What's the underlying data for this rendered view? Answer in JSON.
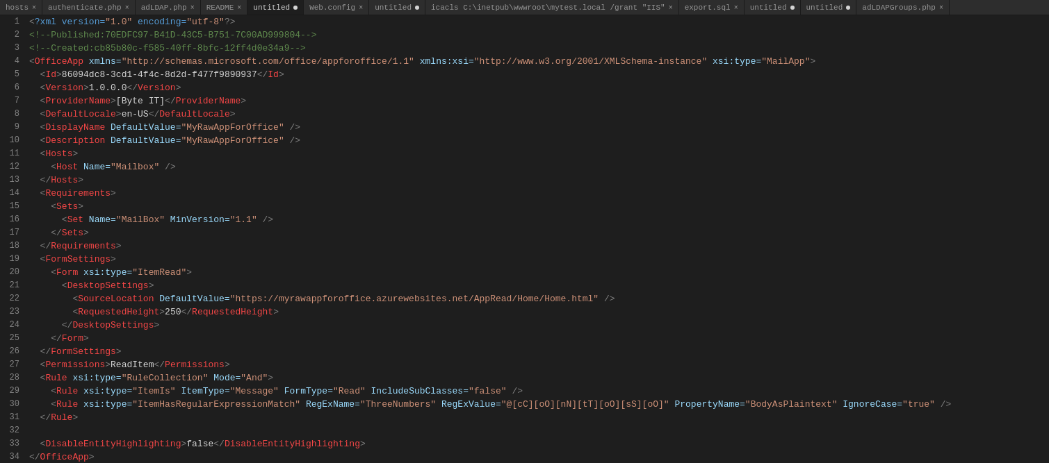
{
  "tabs": [
    {
      "label": "hosts",
      "active": false,
      "closable": true,
      "modified": false
    },
    {
      "label": "authenticate.php",
      "active": false,
      "closable": true,
      "modified": false
    },
    {
      "label": "adLDAP.php",
      "active": false,
      "closable": true,
      "modified": false
    },
    {
      "label": "README",
      "active": false,
      "closable": true,
      "modified": false
    },
    {
      "label": "untitled",
      "active": true,
      "closable": true,
      "modified": true
    },
    {
      "label": "Web.config",
      "active": false,
      "closable": true,
      "modified": false
    },
    {
      "label": "untitled",
      "active": false,
      "closable": true,
      "modified": true
    },
    {
      "label": "icacls C:\\inetpub\\wwwroot\\mytest.local /grant \"IIS\"",
      "active": false,
      "closable": true,
      "modified": false
    },
    {
      "label": "export.sql",
      "active": false,
      "closable": true,
      "modified": false
    },
    {
      "label": "untitled",
      "active": false,
      "closable": true,
      "modified": true
    },
    {
      "label": "untitled",
      "active": false,
      "closable": true,
      "modified": true
    },
    {
      "label": "adLDAPGroups.php",
      "active": false,
      "closable": true,
      "modified": false
    }
  ],
  "lines": [
    {
      "num": 1,
      "html": "<span class='lt'>&lt;</span><span class='pi'>?xml version=</span><span class='pi-val'>\"1.0\"</span><span class='pi'> encoding=</span><span class='pi-val'>\"utf-8\"</span><span class='lt'>?&gt;</span>"
    },
    {
      "num": 2,
      "html": "<span class='comment'>&lt;!--Published:70EDFC97-B41D-43C5-B751-7C00AD999804--&gt;</span>"
    },
    {
      "num": 3,
      "html": "<span class='comment'>&lt;!--Created:cb85b80c-f585-40ff-8bfc-12ff4d0e34a9--&gt;</span>"
    },
    {
      "num": 4,
      "html": "<span class='lt'>&lt;</span><span class='tag'>OfficeApp</span><span class='attr'> xmlns=</span><span class='attr-val'>\"http://schemas.microsoft.com/office/appforoffice/1.1\"</span><span class='attr'> xmlns:xsi=</span><span class='attr-val'>\"http://www.w3.org/2001/XMLSchema-instance\"</span><span class='attr'> xsi:type=</span><span class='attr-val'>\"MailApp\"</span><span class='lt'>&gt;</span>"
    },
    {
      "num": 5,
      "html": "  <span class='lt'>&lt;</span><span class='tag'>Id</span><span class='lt'>&gt;</span><span class='text-content'>86094dc8-3cd1-4f4c-8d2d-f477f9890937</span><span class='lt'>&lt;/</span><span class='tag'>Id</span><span class='lt'>&gt;</span>"
    },
    {
      "num": 6,
      "html": "  <span class='lt'>&lt;</span><span class='tag'>Version</span><span class='lt'>&gt;</span><span class='text-content'>1.0.0.0</span><span class='lt'>&lt;/</span><span class='tag'>Version</span><span class='lt'>&gt;</span>"
    },
    {
      "num": 7,
      "html": "  <span class='lt'>&lt;</span><span class='tag'>ProviderName</span><span class='lt'>&gt;</span><span class='text-content'>[Byte IT]</span><span class='lt'>&lt;/</span><span class='tag'>ProviderName</span><span class='lt'>&gt;</span>"
    },
    {
      "num": 8,
      "html": "  <span class='lt'>&lt;</span><span class='tag'>DefaultLocale</span><span class='lt'>&gt;</span><span class='text-content'>en-US</span><span class='lt'>&lt;/</span><span class='tag'>DefaultLocale</span><span class='lt'>&gt;</span>"
    },
    {
      "num": 9,
      "html": "  <span class='lt'>&lt;</span><span class='tag'>DisplayName</span><span class='attr'> DefaultValue=</span><span class='attr-val'>\"MyRawAppForOffice\"</span><span class='lt'> /&gt;</span>"
    },
    {
      "num": 10,
      "html": "  <span class='lt'>&lt;</span><span class='tag'>Description</span><span class='attr'> DefaultValue=</span><span class='attr-val'>\"MyRawAppForOffice\"</span><span class='lt'> /&gt;</span>"
    },
    {
      "num": 11,
      "html": "  <span class='lt'>&lt;</span><span class='tag'>Hosts</span><span class='lt'>&gt;</span>"
    },
    {
      "num": 12,
      "html": "    <span class='lt'>&lt;</span><span class='tag'>Host</span><span class='attr'> Name=</span><span class='attr-val'>\"Mailbox\"</span><span class='lt'> /&gt;</span>"
    },
    {
      "num": 13,
      "html": "  <span class='lt'>&lt;/</span><span class='tag'>Hosts</span><span class='lt'>&gt;</span>"
    },
    {
      "num": 14,
      "html": "  <span class='lt'>&lt;</span><span class='tag'>Requirements</span><span class='lt'>&gt;</span>"
    },
    {
      "num": 15,
      "html": "    <span class='lt'>&lt;</span><span class='tag'>Sets</span><span class='lt'>&gt;</span>"
    },
    {
      "num": 16,
      "html": "      <span class='lt'>&lt;</span><span class='tag'>Set</span><span class='attr'> Name=</span><span class='attr-val'>\"MailBox\"</span><span class='attr'> MinVersion=</span><span class='attr-val'>\"1.1\"</span><span class='lt'> /&gt;</span>"
    },
    {
      "num": 17,
      "html": "    <span class='lt'>&lt;/</span><span class='tag'>Sets</span><span class='lt'>&gt;</span>"
    },
    {
      "num": 18,
      "html": "  <span class='lt'>&lt;/</span><span class='tag'>Requirements</span><span class='lt'>&gt;</span>"
    },
    {
      "num": 19,
      "html": "  <span class='lt'>&lt;</span><span class='tag'>FormSettings</span><span class='lt'>&gt;</span>"
    },
    {
      "num": 20,
      "html": "    <span class='lt'>&lt;</span><span class='tag'>Form</span><span class='attr'> xsi:type=</span><span class='attr-val'>\"ItemRead\"</span><span class='lt'>&gt;</span>"
    },
    {
      "num": 21,
      "html": "      <span class='lt'>&lt;</span><span class='tag'>DesktopSettings</span><span class='lt'>&gt;</span>"
    },
    {
      "num": 22,
      "html": "        <span class='lt'>&lt;</span><span class='tag'>SourceLocation</span><span class='attr'> DefaultValue=</span><span class='attr-val'>\"https://myrawappforoffice.azurewebsites.net/AppRead/Home/Home.html\"</span><span class='lt'> /&gt;</span>"
    },
    {
      "num": 23,
      "html": "        <span class='lt'>&lt;</span><span class='tag'>RequestedHeight</span><span class='lt'>&gt;</span><span class='text-content'>250</span><span class='lt'>&lt;/</span><span class='tag'>RequestedHeight</span><span class='lt'>&gt;</span>"
    },
    {
      "num": 24,
      "html": "      <span class='lt'>&lt;/</span><span class='tag'>DesktopSettings</span><span class='lt'>&gt;</span>"
    },
    {
      "num": 25,
      "html": "    <span class='lt'>&lt;/</span><span class='tag'>Form</span><span class='lt'>&gt;</span>"
    },
    {
      "num": 26,
      "html": "  <span class='lt'>&lt;/</span><span class='tag'>FormSettings</span><span class='lt'>&gt;</span>"
    },
    {
      "num": 27,
      "html": "  <span class='lt'>&lt;</span><span class='tag'>Permissions</span><span class='lt'>&gt;</span><span class='text-content'>ReadItem</span><span class='lt'>&lt;/</span><span class='tag'>Permissions</span><span class='lt'>&gt;</span>"
    },
    {
      "num": 28,
      "html": "  <span class='lt'>&lt;</span><span class='tag'>Rule</span><span class='attr'> xsi:type=</span><span class='attr-val'>\"RuleCollection\"</span><span class='attr'> Mode=</span><span class='attr-val'>\"And\"</span><span class='lt'>&gt;</span>"
    },
    {
      "num": 29,
      "html": "    <span class='lt'>&lt;</span><span class='tag'>Rule</span><span class='attr'> xsi:type=</span><span class='attr-val'>\"ItemIs\"</span><span class='attr'> ItemType=</span><span class='attr-val'>\"Message\"</span><span class='attr'> FormType=</span><span class='attr-val'>\"Read\"</span><span class='attr'> IncludeSubClasses=</span><span class='attr-val'>\"false\"</span><span class='lt'> /&gt;</span>"
    },
    {
      "num": 30,
      "html": "    <span class='lt'>&lt;</span><span class='tag'>Rule</span><span class='attr'> xsi:type=</span><span class='attr-val'>\"ItemHasRegularExpressionMatch\"</span><span class='attr'> RegExName=</span><span class='attr-val'>\"ThreeNumbers\"</span><span class='attr'> RegExValue=</span><span class='attr-val'>\"@[cC][oO][nN][tT][oO][sS][oO]\"</span><span class='attr'> PropertyName=</span><span class='attr-val'>\"BodyAsPlaintext\"</span><span class='attr'> IgnoreCase=</span><span class='attr-val'>\"true\"</span><span class='lt'> /&gt;</span>"
    },
    {
      "num": 31,
      "html": "  <span class='lt'>&lt;/</span><span class='tag'>Rule</span><span class='lt'>&gt;</span>"
    },
    {
      "num": 32,
      "html": ""
    },
    {
      "num": 33,
      "html": "  <span class='lt'>&lt;</span><span class='tag'>DisableEntityHighlighting</span><span class='lt'>&gt;</span><span class='text-content'>false</span><span class='lt'>&lt;/</span><span class='tag'>DisableEntityHighlighting</span><span class='lt'>&gt;</span>"
    },
    {
      "num": 34,
      "html": "<span class='lt'>&lt;/</span><span class='tag'>OfficeApp</span><span class='lt'>&gt;</span>"
    }
  ]
}
